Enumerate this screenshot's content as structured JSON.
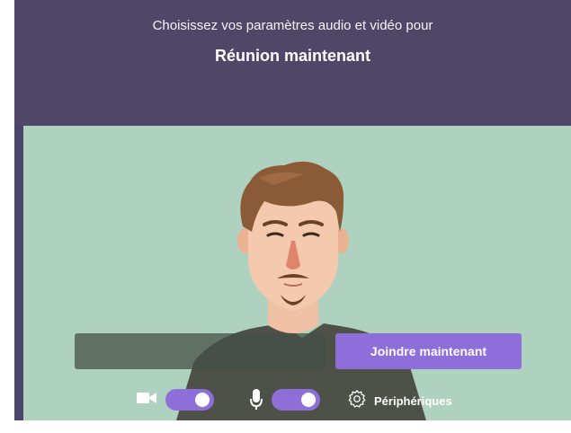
{
  "header": {
    "subtitle": "Choisissez vos paramètres audio et vidéo pour",
    "title": "Réunion maintenant"
  },
  "name_input": {
    "value": "",
    "placeholder": ""
  },
  "join_button": {
    "label": "Joindre maintenant"
  },
  "controls": {
    "camera": {
      "icon": "camera-icon",
      "enabled": true
    },
    "microphone": {
      "icon": "microphone-icon",
      "enabled": true
    },
    "devices": {
      "icon": "gear-icon",
      "label": "Périphériques"
    }
  },
  "colors": {
    "header_bg": "#4e4767",
    "preview_bg": "#aed1c0",
    "accent": "#8e6ed8"
  }
}
